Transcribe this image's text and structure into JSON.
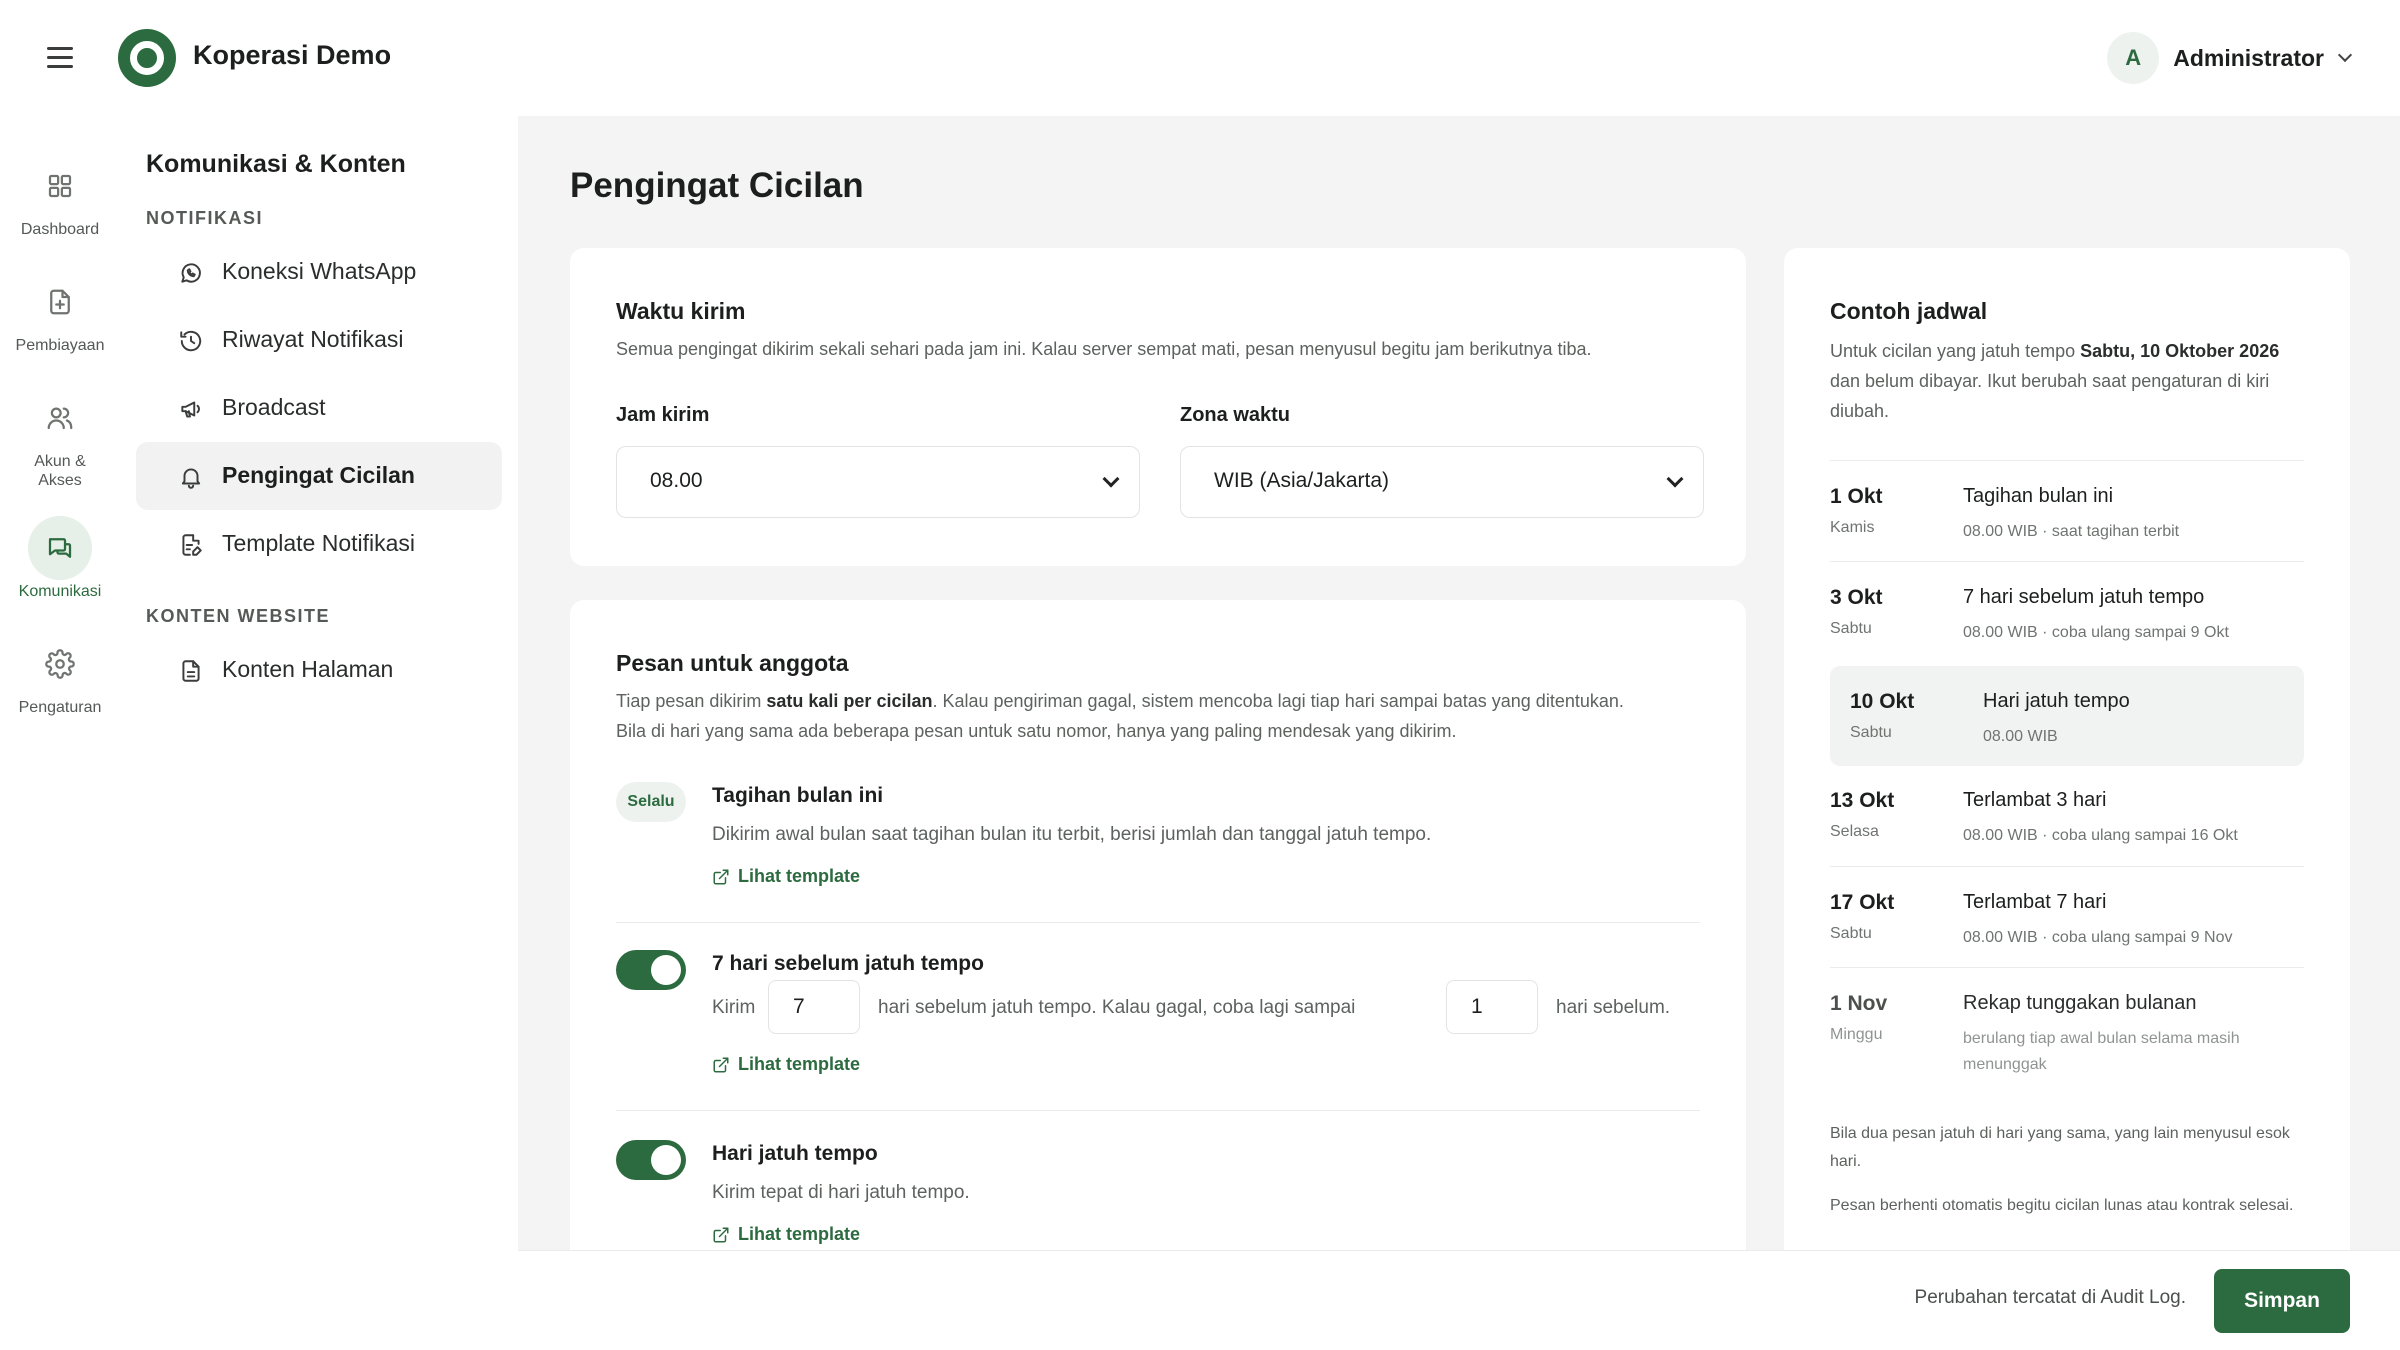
{
  "app": {
    "name": "Koperasi Demo"
  },
  "user": {
    "initial": "A",
    "name": "Administrator"
  },
  "rail": [
    {
      "label": "Dashboard"
    },
    {
      "label": "Pembiayaan"
    },
    {
      "label": "Akun & Akses"
    },
    {
      "label": "Komunikasi"
    },
    {
      "label": "Pengaturan"
    }
  ],
  "subnav": {
    "title": "Komunikasi & Konten",
    "section_notifikasi": "NOTIFIKASI",
    "items_notifikasi": [
      {
        "label": "Koneksi WhatsApp"
      },
      {
        "label": "Riwayat Notifikasi"
      },
      {
        "label": "Broadcast"
      },
      {
        "label": "Pengingat Cicilan"
      },
      {
        "label": "Template Notifikasi"
      }
    ],
    "section_website": "KONTEN WEBSITE",
    "items_website": [
      {
        "label": "Konten Halaman"
      }
    ]
  },
  "page": {
    "title": "Pengingat Cicilan"
  },
  "waktu": {
    "title": "Waktu kirim",
    "desc": "Semua pengingat dikirim sekali sehari pada jam ini. Kalau server sempat mati, pesan menyusul begitu jam berikutnya tiba.",
    "jam_label": "Jam kirim",
    "jam_value": "08.00",
    "zona_label": "Zona waktu",
    "zona_value": "WIB (Asia/Jakarta)"
  },
  "pesan": {
    "title": "Pesan untuk anggota",
    "desc1_a": "Tiap pesan dikirim ",
    "desc1_b": "satu kali per cicilan",
    "desc1_c": ". Kalau pengiriman gagal, sistem mencoba lagi tiap hari sampai batas yang ditentukan.",
    "desc2": "Bila di hari yang sama ada beberapa pesan untuk satu nomor, hanya yang paling mendesak yang dikirim.",
    "link_label": "Lihat template",
    "rows": [
      {
        "badge": "Selalu",
        "title": "Tagihan bulan ini",
        "desc": "Dikirim awal bulan saat tagihan bulan itu terbit, berisi jumlah dan tanggal jatuh tempo."
      },
      {
        "title": "7 hari sebelum jatuh tempo",
        "kirim": "Kirim",
        "days_before": "7",
        "mid": "hari sebelum jatuh tempo. Kalau gagal, coba lagi sampai",
        "retry_until": "1",
        "end": "hari sebelum."
      },
      {
        "title": "Hari jatuh tempo",
        "desc": "Kirim tepat di hari jatuh tempo."
      }
    ]
  },
  "jadwal": {
    "title": "Contoh jadwal",
    "desc_a": "Untuk cicilan yang jatuh tempo ",
    "desc_b": "Sabtu, 10 Oktober 2026",
    "desc_c": " dan belum dibayar. Ikut berubah saat pengaturan di kiri diubah.",
    "rows": [
      {
        "date": "1 Okt",
        "day": "Kamis",
        "label": "Tagihan bulan ini",
        "sub": "08.00 WIB · saat tagihan terbit"
      },
      {
        "date": "3 Okt",
        "day": "Sabtu",
        "label": "7 hari sebelum jatuh tempo",
        "sub": "08.00 WIB · coba ulang sampai 9 Okt"
      },
      {
        "date": "10 Okt",
        "day": "Sabtu",
        "label": "Hari jatuh tempo",
        "sub": "08.00 WIB"
      },
      {
        "date": "13 Okt",
        "day": "Selasa",
        "label": "Terlambat 3 hari",
        "sub": "08.00 WIB · coba ulang sampai 16 Okt"
      },
      {
        "date": "17 Okt",
        "day": "Sabtu",
        "label": "Terlambat 7 hari",
        "sub": "08.00 WIB · coba ulang sampai 9 Nov"
      },
      {
        "date": "1 Nov",
        "day": "Minggu",
        "label": "Rekap tunggakan bulanan",
        "sub": "berulang tiap awal bulan selama masih menunggak"
      }
    ],
    "note1": "Bila dua pesan jatuh di hari yang sama, yang lain menyusul esok hari.",
    "note2": "Pesan berhenti otomatis begitu cicilan lunas atau kontrak selesai."
  },
  "footer": {
    "note": "Perubahan tercatat di Audit Log.",
    "save_label": "Simpan"
  },
  "colors": {
    "accent": "#2c6b3f",
    "main_bg": "#f4f4f4"
  }
}
